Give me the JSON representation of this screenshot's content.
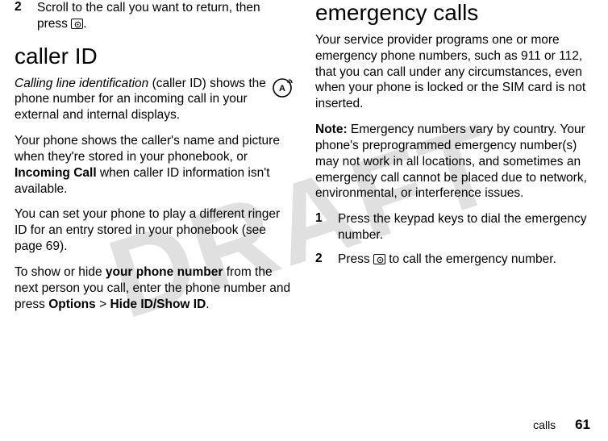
{
  "watermark": "DRAFT",
  "left": {
    "step2_num": "2",
    "step2_a": "Scroll to the call you want to return, then press ",
    "step2_b": ".",
    "h_callerid": "caller ID",
    "p1_a": "Calling line identification",
    "p1_b": " (caller ID) shows the phone number for an incoming call in your external and internal displays.",
    "p2_a": "Your phone shows the caller's name and picture when they're stored in your phonebook, or ",
    "p2_b": "Incoming Call",
    "p2_c": " when caller ID information isn't available.",
    "p3": "You can set your phone to play a different ringer ID for an entry stored in your phonebook (see page 69).",
    "p4_a": "To show or hide ",
    "p4_b": "your phone number",
    "p4_c": " from the next person you call, enter the phone number and press ",
    "p4_d": "Options",
    "p4_e": " > ",
    "p4_f": "Hide ID/Show ID",
    "p4_g": "."
  },
  "right": {
    "h_emergency": "emergency calls",
    "p1": "Your service provider programs one or more emergency phone numbers, such as 911 or 112, that you can call under any circumstances, even when your phone is locked or the SIM card is not inserted.",
    "p2_a": "Note:",
    "p2_b": " Emergency numbers vary by country. Your phone's preprogrammed emergency number(s) may not work in all locations, and sometimes an emergency call cannot be placed due to network, environmental, or interference issues.",
    "s1_num": "1",
    "s1": "Press the keypad keys to dial the emergency number.",
    "s2_num": "2",
    "s2_a": "Press ",
    "s2_b": " to call the emergency number."
  },
  "footer": {
    "section": "calls",
    "page": "61"
  }
}
